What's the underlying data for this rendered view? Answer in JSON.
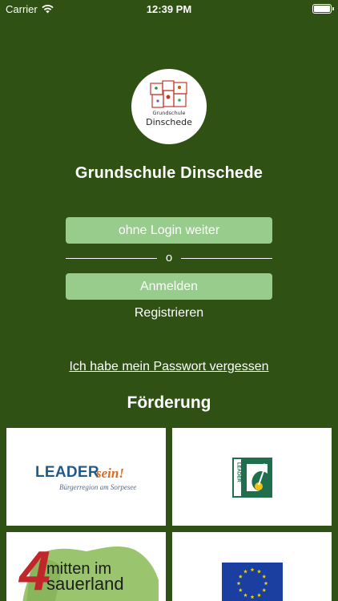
{
  "status_bar": {
    "carrier": "Carrier",
    "time": "12:39 PM"
  },
  "logo": {
    "line1": "Grundschule",
    "line2": "Dinschede"
  },
  "title": "Grundschule Dinschede",
  "buttons": {
    "guest": "ohne Login weiter",
    "divider": "o",
    "login": "Anmelden",
    "register": "Registrieren",
    "forgot_password": "Ich habe mein Passwort vergessen"
  },
  "funding": {
    "title": "Förderung",
    "cards": {
      "leader_sein": {
        "word": "LEADER",
        "suffix": "sein!",
        "subtitle": "Bürgerregion am Sorpesee"
      },
      "leader_logo": {
        "vertical_text": "LEADER"
      },
      "mitten": {
        "numeral": "4",
        "line1": "mitten im",
        "line2": "sauerland"
      },
      "eu": {
        "icon": "eu-flag-icon"
      }
    }
  },
  "colors": {
    "background": "#2f5114",
    "button": "#98cc8c",
    "leader_blue": "#1f5a8a",
    "leader_orange": "#e06a1f",
    "leader_green": "#1f6e4e",
    "eu_blue": "#1a3fa0",
    "eu_yellow": "#f5d300"
  }
}
